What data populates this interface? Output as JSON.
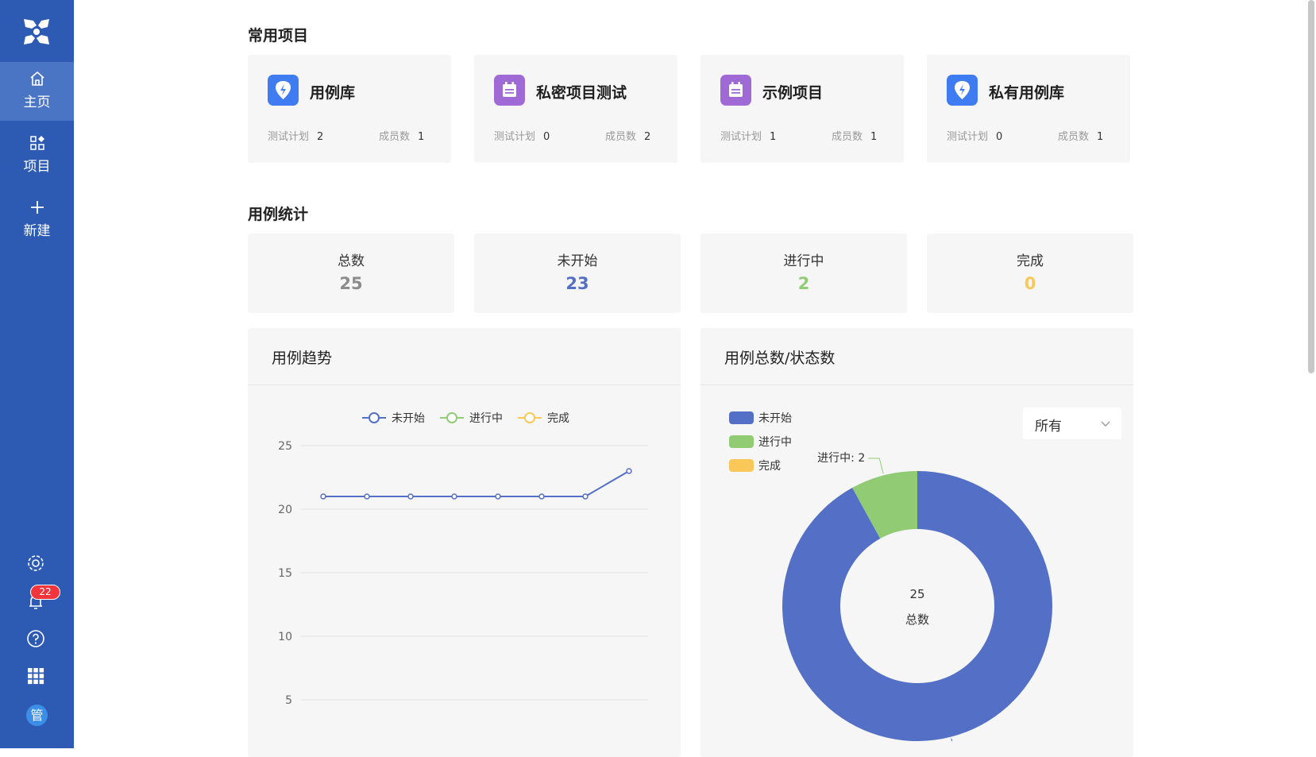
{
  "sidebar": {
    "items": [
      {
        "label": "主页",
        "icon": "home-icon",
        "active": true
      },
      {
        "label": "项目",
        "icon": "apps-icon",
        "active": false
      },
      {
        "label": "新建",
        "icon": "plus-icon",
        "active": false
      }
    ],
    "notification_count": "22",
    "avatar_text": "管",
    "colors": {
      "bg": "#2d5bb4",
      "active": "#4a74c4"
    }
  },
  "recent_projects": {
    "title": "常用项目",
    "plan_label": "测试计划",
    "members_label": "成员数",
    "items": [
      {
        "name": "用例库",
        "plans": "2",
        "members": "1",
        "icon": "shield-icon",
        "color": "#3f7cf2"
      },
      {
        "name": "私密项目测试",
        "plans": "0",
        "members": "2",
        "icon": "calendar-icon",
        "color": "#a06ad6"
      },
      {
        "name": "示例项目",
        "plans": "1",
        "members": "1",
        "icon": "calendar-icon",
        "color": "#a06ad6"
      },
      {
        "name": "私有用例库",
        "plans": "0",
        "members": "1",
        "icon": "shield-icon",
        "color": "#3f7cf2"
      }
    ]
  },
  "case_stats": {
    "title": "用例统计",
    "items": [
      {
        "label": "总数",
        "value": "25",
        "color": "#8c8c8c"
      },
      {
        "label": "未开始",
        "value": "23",
        "color": "#5470c6"
      },
      {
        "label": "进行中",
        "value": "2",
        "color": "#91cc75"
      },
      {
        "label": "完成",
        "value": "0",
        "color": "#fac858"
      }
    ]
  },
  "trend_panel": {
    "title": "用例趋势"
  },
  "status_panel": {
    "title": "用例总数/状态数",
    "filter_value": "所有"
  },
  "chart_data": [
    {
      "type": "line",
      "title": "用例趋势",
      "x": [
        "",
        "",
        "",
        "",
        "",
        "",
        "",
        ""
      ],
      "yticks": [
        5,
        10,
        15,
        20,
        25
      ],
      "ylim": [
        0,
        25
      ],
      "legend_position": "top",
      "grid": true,
      "series": [
        {
          "name": "未开始",
          "color": "#5470c6",
          "values": [
            21,
            21,
            21,
            21,
            21,
            21,
            21,
            23
          ]
        },
        {
          "name": "进行中",
          "color": "#91cc75",
          "values": [
            0,
            0,
            0,
            0,
            0,
            0,
            0,
            0
          ]
        },
        {
          "name": "完成",
          "color": "#fac858",
          "values": [
            0,
            0,
            0,
            0,
            0,
            0,
            0,
            0
          ]
        }
      ]
    },
    {
      "type": "pie",
      "title": "用例总数/状态数",
      "center_value": "25",
      "center_label": "总数",
      "legend_position": "top-left",
      "slices": [
        {
          "name": "未开始",
          "value": 23,
          "color": "#5470c6",
          "label": "未开始: 23"
        },
        {
          "name": "进行中",
          "value": 2,
          "color": "#91cc75",
          "label": "进行中: 2"
        },
        {
          "name": "完成",
          "value": 0,
          "color": "#fac858",
          "label": ""
        }
      ]
    }
  ]
}
